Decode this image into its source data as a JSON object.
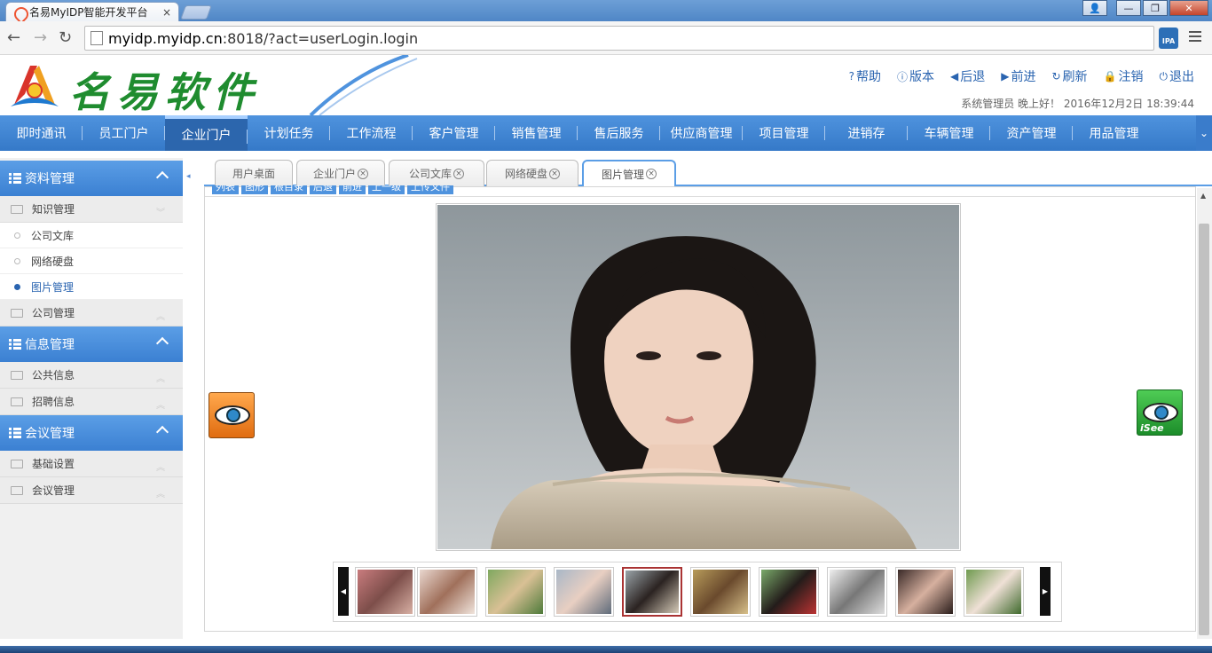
{
  "browser": {
    "tab_title": "名易MyIDP智能开发平台",
    "tab_close": "×",
    "url_host": "myidp.myidp.cn",
    "url_rest": ":8018/?act=userLogin.login",
    "ipa_label": "IPA"
  },
  "header": {
    "brand": "名易软件",
    "toolbar": [
      {
        "icon": "?",
        "label": "帮助"
      },
      {
        "icon": "ⓘ",
        "label": "版本"
      },
      {
        "icon": "◀",
        "label": "后退"
      },
      {
        "icon": "▶",
        "label": "前进"
      },
      {
        "icon": "↻",
        "label": "刷新"
      },
      {
        "icon": "🔒",
        "label": "注销"
      },
      {
        "icon": "⏻",
        "label": "退出"
      }
    ],
    "greeting": "系统管理员 晚上好！ 2016年12月2日 18:39:44"
  },
  "mainnav": {
    "items": [
      "即时通讯",
      "员工门户",
      "企业门户",
      "计划任务",
      "工作流程",
      "客户管理",
      "销售管理",
      "售后服务",
      "供应商管理",
      "项目管理",
      "进销存",
      "车辆管理",
      "资产管理",
      "用品管理"
    ],
    "active": "企业门户"
  },
  "sidebar": {
    "sections": [
      {
        "title": "资料管理",
        "groups": [
          {
            "label": "知识管理",
            "children": [
              "公司文库",
              "网络硬盘",
              "图片管理"
            ]
          },
          {
            "label": "公司管理"
          }
        ]
      },
      {
        "title": "信息管理",
        "groups": [
          {
            "label": "公共信息"
          },
          {
            "label": "招聘信息"
          }
        ]
      },
      {
        "title": "会议管理",
        "groups": [
          {
            "label": "基础设置"
          },
          {
            "label": "会议管理"
          }
        ]
      }
    ],
    "selected": "图片管理"
  },
  "tabs": [
    {
      "label": "用户桌面",
      "closable": false
    },
    {
      "label": "企业门户",
      "closable": true
    },
    {
      "label": "公司文库",
      "closable": true
    },
    {
      "label": "网络硬盘",
      "closable": true
    },
    {
      "label": "图片管理",
      "closable": true,
      "active": true
    }
  ],
  "panel_toolbar": [
    "列表",
    "图形",
    "根目录",
    "后退",
    "前进",
    "上一级",
    "上传文件"
  ],
  "viewer": {
    "left_icon": "isee-eye-icon",
    "right_icon": "isee-logo-icon",
    "right_label": "iSee",
    "thumbnails": 10,
    "selected_thumbnail": 5
  },
  "colors": {
    "accent": "#3b80d2",
    "brand_green": "#1f8c2f",
    "link": "#2a64b0"
  }
}
